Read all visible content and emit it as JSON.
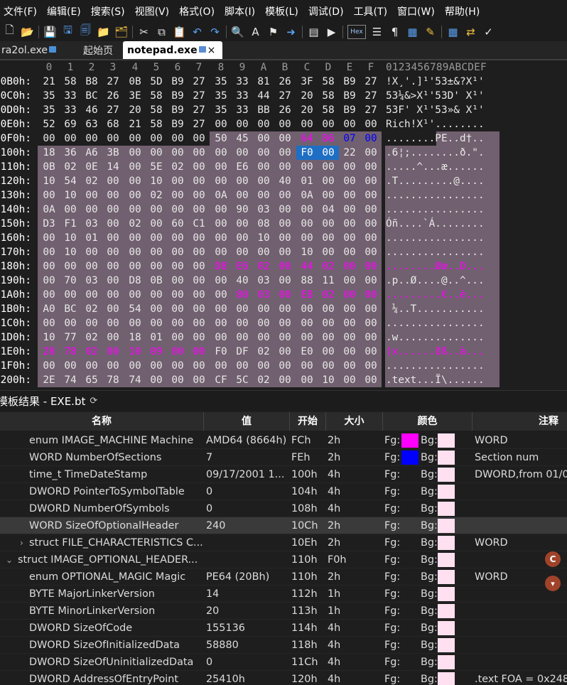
{
  "menu": [
    "文件(F)",
    "编辑(E)",
    "搜索(S)",
    "视图(V)",
    "格式(O)",
    "脚本(I)",
    "模板(L)",
    "调试(D)",
    "工具(T)",
    "窗口(W)",
    "帮助(H)"
  ],
  "toolbar_icons": [
    "new-file-icon",
    "open-folder-icon",
    "save-icon",
    "save-as-icon",
    "save-all-icon",
    "folder-icon",
    "multi-folder-icon",
    "cut-icon",
    "copy-icon",
    "paste-icon",
    "undo-icon",
    "redo-icon",
    "find-icon",
    "replace-icon",
    "find-in-files-icon",
    "goto-icon",
    "template-icon",
    "run-template-icon",
    "hex-mode-icon",
    "text-mode-icon",
    "paragraph-icon",
    "columns-icon",
    "highlight-icon",
    "calculator-icon",
    "compare-icon",
    "checksum-icon"
  ],
  "toolbar_hex_label": "Hex",
  "tabs": [
    {
      "label": "ra2ol.exe",
      "active": false
    },
    {
      "label": "起始页",
      "active": false
    },
    {
      "label": "notepad.exe",
      "active": true,
      "close": "×"
    }
  ],
  "hex": {
    "columns": [
      "0",
      "1",
      "2",
      "3",
      "4",
      "5",
      "6",
      "7",
      "8",
      "9",
      "A",
      "B",
      "C",
      "D",
      "E",
      "F"
    ],
    "ascii_header": "0123456789ABCDEF",
    "rows": [
      {
        "addr": "00B0h:",
        "bytes": [
          "21",
          "58",
          "B8",
          "27",
          "0B",
          "5D",
          "B9",
          "27",
          "35",
          "33",
          "81",
          "26",
          "3F",
          "58",
          "B9",
          "27"
        ],
        "ascii": "!X¸'.]¹'53±&?X¹'"
      },
      {
        "addr": "00C0h:",
        "bytes": [
          "35",
          "33",
          "BC",
          "26",
          "3E",
          "58",
          "B9",
          "27",
          "35",
          "33",
          "44",
          "27",
          "20",
          "58",
          "B9",
          "27"
        ],
        "ascii": "53¼&>X¹'53D' X¹'"
      },
      {
        "addr": "00D0h:",
        "bytes": [
          "35",
          "33",
          "46",
          "27",
          "20",
          "58",
          "B9",
          "27",
          "35",
          "33",
          "BB",
          "26",
          "20",
          "58",
          "B9",
          "27"
        ],
        "ascii": "53F' X¹'53»& X¹'"
      },
      {
        "addr": "00E0h:",
        "bytes": [
          "52",
          "69",
          "63",
          "68",
          "21",
          "58",
          "B9",
          "27",
          "00",
          "00",
          "00",
          "00",
          "00",
          "00",
          "00",
          "00"
        ],
        "ascii": "Rich!X¹'........"
      },
      {
        "addr": "00F0h:",
        "bytes": [
          "00",
          "00",
          "00",
          "00",
          "00",
          "00",
          "00",
          "00",
          "50",
          "45",
          "00",
          "00",
          "64",
          "86",
          "07",
          "00"
        ],
        "ascii": "........PE..d†.."
      },
      {
        "addr": "0100h:",
        "bytes": [
          "18",
          "36",
          "A6",
          "3B",
          "00",
          "00",
          "00",
          "00",
          "00",
          "00",
          "00",
          "00",
          "F0",
          "00",
          "22",
          "00"
        ],
        "ascii": ".6¦;........ð.\"."
      },
      {
        "addr": "0110h:",
        "bytes": [
          "0B",
          "02",
          "0E",
          "14",
          "00",
          "5E",
          "02",
          "00",
          "00",
          "E6",
          "00",
          "00",
          "00",
          "00",
          "00",
          "00"
        ],
        "ascii": ".....^...æ......"
      },
      {
        "addr": "0120h:",
        "bytes": [
          "10",
          "54",
          "02",
          "00",
          "00",
          "10",
          "00",
          "00",
          "00",
          "00",
          "00",
          "40",
          "01",
          "00",
          "00",
          "00"
        ],
        "ascii": ".T.........@...."
      },
      {
        "addr": "0130h:",
        "bytes": [
          "00",
          "10",
          "00",
          "00",
          "00",
          "02",
          "00",
          "00",
          "0A",
          "00",
          "00",
          "00",
          "0A",
          "00",
          "00",
          "00"
        ],
        "ascii": "................"
      },
      {
        "addr": "0140h:",
        "bytes": [
          "0A",
          "00",
          "00",
          "00",
          "00",
          "00",
          "00",
          "00",
          "00",
          "90",
          "03",
          "00",
          "00",
          "04",
          "00",
          "00"
        ],
        "ascii": "................"
      },
      {
        "addr": "0150h:",
        "bytes": [
          "D3",
          "F1",
          "03",
          "00",
          "02",
          "00",
          "60",
          "C1",
          "00",
          "00",
          "08",
          "00",
          "00",
          "00",
          "00",
          "00"
        ],
        "ascii": "Óñ....`Á........"
      },
      {
        "addr": "0160h:",
        "bytes": [
          "00",
          "10",
          "01",
          "00",
          "00",
          "00",
          "00",
          "00",
          "00",
          "00",
          "10",
          "00",
          "00",
          "00",
          "00",
          "00"
        ],
        "ascii": "................"
      },
      {
        "addr": "0170h:",
        "bytes": [
          "00",
          "10",
          "00",
          "00",
          "00",
          "00",
          "00",
          "00",
          "00",
          "00",
          "00",
          "00",
          "10",
          "00",
          "00",
          "00"
        ],
        "ascii": "................"
      },
      {
        "addr": "0180h:",
        "bytes": [
          "00",
          "00",
          "00",
          "00",
          "00",
          "00",
          "00",
          "00",
          "D8",
          "E6",
          "02",
          "00",
          "44",
          "02",
          "00",
          "00"
        ],
        "ascii": "........Øæ..D..."
      },
      {
        "addr": "0190h:",
        "bytes": [
          "00",
          "70",
          "03",
          "00",
          "D8",
          "0B",
          "00",
          "00",
          "00",
          "40",
          "03",
          "00",
          "88",
          "11",
          "00",
          "00"
        ],
        "ascii": ".p..Ø....@..^..."
      },
      {
        "addr": "01A0h:",
        "bytes": [
          "00",
          "00",
          "00",
          "00",
          "00",
          "00",
          "00",
          "00",
          "00",
          "80",
          "03",
          "00",
          "E8",
          "02",
          "00",
          "00"
        ],
        "ascii": ".........€..è..."
      },
      {
        "addr": "01B0h:",
        "bytes": [
          "A0",
          "BC",
          "02",
          "00",
          "54",
          "00",
          "00",
          "00",
          "00",
          "00",
          "00",
          "00",
          "00",
          "00",
          "00",
          "00"
        ],
        "ascii": " ¼..T..........."
      },
      {
        "addr": "01C0h:",
        "bytes": [
          "00",
          "00",
          "00",
          "00",
          "00",
          "00",
          "00",
          "00",
          "00",
          "00",
          "00",
          "00",
          "00",
          "00",
          "00",
          "00"
        ],
        "ascii": "................"
      },
      {
        "addr": "01D0h:",
        "bytes": [
          "10",
          "77",
          "02",
          "00",
          "18",
          "01",
          "00",
          "00",
          "00",
          "00",
          "00",
          "00",
          "00",
          "00",
          "00",
          "00"
        ],
        "ascii": ".w.............."
      },
      {
        "addr": "01E0h:",
        "bytes": [
          "28",
          "78",
          "02",
          "00",
          "10",
          "09",
          "00",
          "00",
          "F0",
          "DF",
          "02",
          "00",
          "E0",
          "00",
          "00",
          "00"
        ],
        "ascii": "(x......ðß..à..."
      },
      {
        "addr": "01F0h:",
        "bytes": [
          "00",
          "00",
          "00",
          "00",
          "00",
          "00",
          "00",
          "00",
          "00",
          "00",
          "00",
          "00",
          "00",
          "00",
          "00",
          "00"
        ],
        "ascii": "................"
      },
      {
        "addr": "0200h:",
        "bytes": [
          "2E",
          "74",
          "65",
          "78",
          "74",
          "00",
          "00",
          "00",
          "CF",
          "5C",
          "02",
          "00",
          "00",
          "10",
          "00",
          "00"
        ],
        "ascii": ".text...Ï\\......"
      }
    ]
  },
  "results": {
    "title": "模板结果 - EXE.bt",
    "refresh_icon": "refresh-icon",
    "headers": {
      "name": "名称",
      "value": "值",
      "start": "开始",
      "size": "大小",
      "color": "颜色",
      "comment": "注释"
    },
    "fg_label": "Fg:",
    "bg_label": "Bg:",
    "bg_color": "#ffe0f0",
    "rows": [
      {
        "name": "enum IMAGE_MACHINE Machine",
        "value": "AMD64 (8664h)",
        "start": "FCh",
        "size": "2h",
        "fg": "#ff00ff",
        "comment": "WORD"
      },
      {
        "name": "WORD NumberOfSections",
        "value": "7",
        "start": "FEh",
        "size": "2h",
        "fg": "#0000ff",
        "comment": "Section num"
      },
      {
        "name": "time_t TimeDateStamp",
        "value": "09/17/2001 1...",
        "start": "100h",
        "size": "4h",
        "fg": "",
        "comment": "DWORD,from 01/0"
      },
      {
        "name": "DWORD PointerToSymbolTable",
        "value": "0",
        "start": "104h",
        "size": "4h",
        "fg": "",
        "comment": ""
      },
      {
        "name": "DWORD NumberOfSymbols",
        "value": "0",
        "start": "108h",
        "size": "4h",
        "fg": "",
        "comment": ""
      },
      {
        "name": "WORD SizeOfOptionalHeader",
        "value": "240",
        "start": "10Ch",
        "size": "2h",
        "fg": "",
        "comment": "",
        "highlight": true
      },
      {
        "name": "struct FILE_CHARACTERISTICS C...",
        "value": "",
        "start": "10Eh",
        "size": "2h",
        "fg": "",
        "comment": "WORD",
        "expander": "›"
      },
      {
        "name": "struct IMAGE_OPTIONAL_HEADER...",
        "value": "",
        "start": "110h",
        "size": "F0h",
        "fg": "",
        "comment": "",
        "expander": "⌄",
        "indent": 0
      },
      {
        "name": "enum OPTIONAL_MAGIC Magic",
        "value": "PE64 (20Bh)",
        "start": "110h",
        "size": "2h",
        "fg": "",
        "comment": "WORD"
      },
      {
        "name": "BYTE MajorLinkerVersion",
        "value": "14",
        "start": "112h",
        "size": "1h",
        "fg": "",
        "comment": ""
      },
      {
        "name": "BYTE MinorLinkerVersion",
        "value": "20",
        "start": "113h",
        "size": "1h",
        "fg": "",
        "comment": ""
      },
      {
        "name": "DWORD SizeOfCode",
        "value": "155136",
        "start": "114h",
        "size": "4h",
        "fg": "",
        "comment": ""
      },
      {
        "name": "DWORD SizeOfInitializedData",
        "value": "58880",
        "start": "118h",
        "size": "4h",
        "fg": "",
        "comment": ""
      },
      {
        "name": "DWORD SizeOfUninitializedData",
        "value": "0",
        "start": "11Ch",
        "size": "4h",
        "fg": "",
        "comment": ""
      },
      {
        "name": "DWORD AddressOfEntryPoint",
        "value": "25410h",
        "start": "120h",
        "size": "4h",
        "fg": "",
        "comment": ".text FOA = 0x248"
      }
    ]
  },
  "floating": [
    {
      "icon": "c-badge-icon",
      "glyph": "C",
      "color": "#a0432a"
    },
    {
      "icon": "shirt-badge-icon",
      "glyph": "👕",
      "color": "#a0432a"
    }
  ]
}
